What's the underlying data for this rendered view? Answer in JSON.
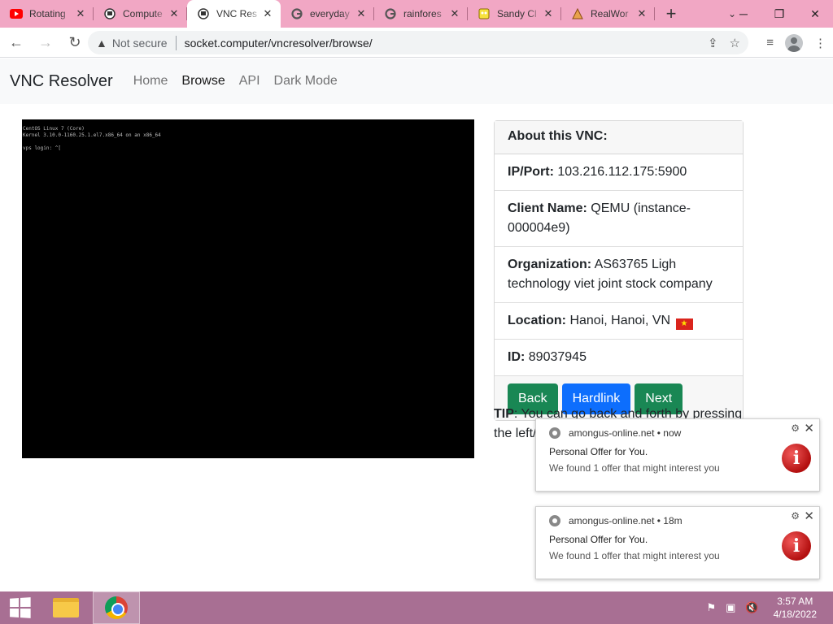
{
  "browser": {
    "tabs": [
      {
        "label": "Rotating",
        "icon": "youtube-icon",
        "active": false
      },
      {
        "label": "Compute",
        "icon": "computer-icon",
        "active": false
      },
      {
        "label": "VNC Res",
        "icon": "computer-icon",
        "active": true
      },
      {
        "label": "everyday",
        "icon": "google-icon",
        "active": false
      },
      {
        "label": "rainfores",
        "icon": "google-icon",
        "active": false
      },
      {
        "label": "Sandy Cl",
        "icon": "spongebob-icon",
        "active": false
      },
      {
        "label": "RealWor",
        "icon": "realworld-icon",
        "active": false
      }
    ],
    "security_label": "Not secure",
    "url": "socket.computer/vncresolver/browse/"
  },
  "site": {
    "brand": "VNC Resolver",
    "nav": [
      "Home",
      "Browse",
      "API",
      "Dark Mode"
    ],
    "active_nav": "Browse"
  },
  "vnc_screen": {
    "lines": [
      "CentOS Linux 7 (Core)",
      "Kernel 3.10.0-1160.25.1.el7.x86_64 on an x86_64",
      "",
      "vps login: ^[",
      ""
    ]
  },
  "card": {
    "header": "About this VNC:",
    "ip_label": "IP/Port:",
    "ip_value": "103.216.112.175:5900",
    "client_label": "Client Name:",
    "client_value": "QEMU (instance-000004e9)",
    "org_label": "Organization:",
    "org_value": "AS63765 Ligh technology viet joint stock company",
    "loc_label": "Location:",
    "loc_value": "Hanoi, Hanoi, VN",
    "id_label": "ID:",
    "id_value": "89037945",
    "buttons": {
      "back": "Back",
      "hardlink": "Hardlink",
      "next": "Next"
    }
  },
  "tip": {
    "label": "TIP",
    "text": ": You can go back and forth by pressing the left/"
  },
  "notifications": [
    {
      "site": "amongus-online.net",
      "time": "now",
      "title": "Personal Offer for You.",
      "body": "We found 1 offer that might interest you"
    },
    {
      "site": "amongus-online.net",
      "time": "18m",
      "title": "Personal Offer for You.",
      "body": "We found 1 offer that might interest you"
    }
  ],
  "taskbar": {
    "time": "3:57 AM",
    "date": "4/18/2022"
  },
  "colors": {
    "tabbar": "#f1a7c4",
    "taskbar": "#a86f93",
    "button_green": "#198754",
    "button_blue": "#0d6efd"
  }
}
